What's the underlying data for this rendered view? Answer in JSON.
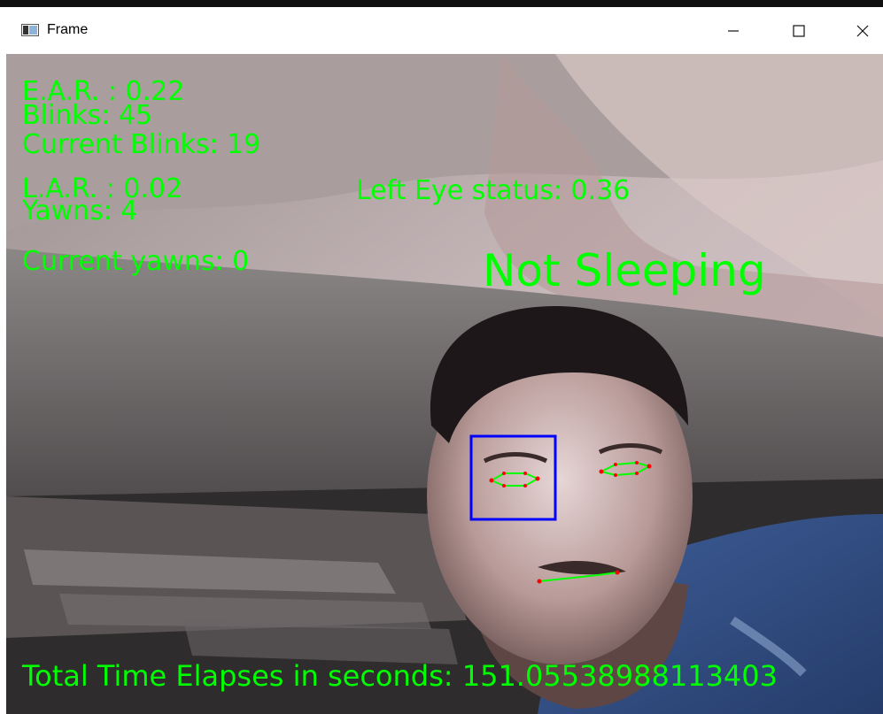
{
  "window": {
    "title": "Frame",
    "minimize_icon": "minimize-icon",
    "maximize_icon": "maximize-icon",
    "close_icon": "close-icon"
  },
  "overlay": {
    "ear": "E.A.R. : 0.22",
    "blinks": "Blinks: 45",
    "current_blinks": "Current Blinks: 19",
    "lar": "L.A.R. : 0.02",
    "yawns": "Yawns: 4",
    "current_yawns": "Current yawns: 0",
    "left_eye_status": "Left Eye status: 0.36",
    "sleep_status": "Not Sleeping",
    "elapsed": "Total Time Elapses in seconds: 151.05538988113403"
  },
  "colors": {
    "overlay_text": "#00ff00",
    "eye_box": "#0000ff",
    "landmark_line": "#00ff00",
    "landmark_point": "#ff0000"
  }
}
